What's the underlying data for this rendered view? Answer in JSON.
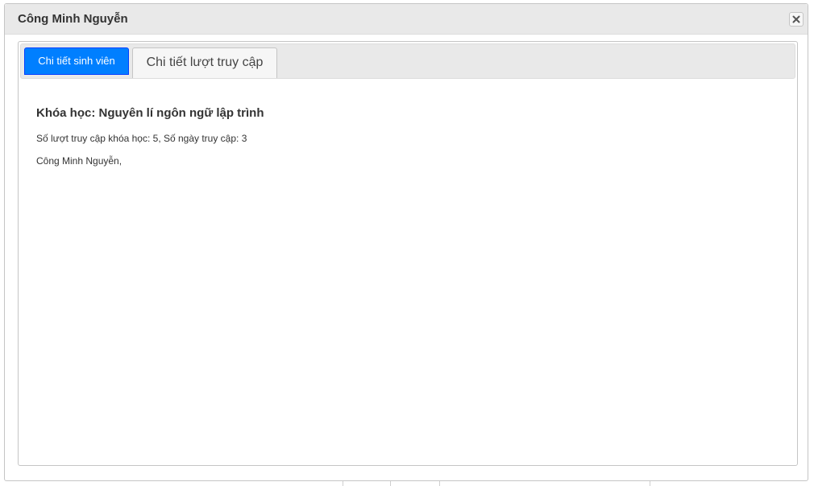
{
  "dialog": {
    "title": "Công Minh Nguyễn",
    "close_icon": "close-x-icon"
  },
  "tabs": [
    {
      "label": "Chi tiết sinh viên",
      "active": true
    },
    {
      "label": "Chi tiết lượt truy cập",
      "active": false
    }
  ],
  "content": {
    "course_title": "Khóa học: Nguyên lí ngôn ngữ lập trình",
    "stats": "Số lượt truy cập khóa học: 5, Số ngày truy cập: 3",
    "student_names": "Công Minh Nguyễn,"
  },
  "colors": {
    "active_tab": "#007fff",
    "titlebar": "#e9e9e9",
    "border": "#c5c5c5"
  }
}
